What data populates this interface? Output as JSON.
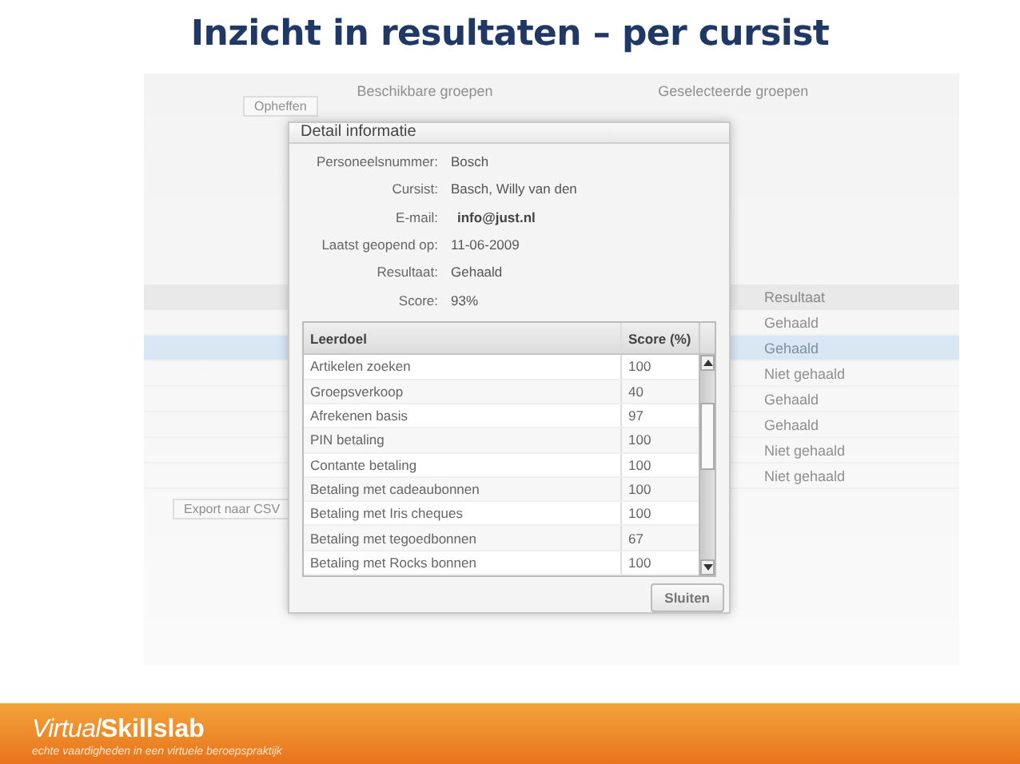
{
  "slide_title": "Inzicht in resultaten – per cursist",
  "background_app": {
    "group_labels": [
      "Beschikbare groepen",
      "Geselecteerde groepen"
    ],
    "buttons": [
      "Opheffen",
      "Export naar CSV"
    ],
    "result_column": "Resultaat",
    "results": [
      {
        "text": "Gehaald",
        "selected": false
      },
      {
        "text": "Gehaald",
        "selected": true
      },
      {
        "text": "Niet gehaald",
        "selected": false
      },
      {
        "text": "Gehaald",
        "selected": false
      },
      {
        "text": "Gehaald",
        "selected": false
      },
      {
        "text": "Niet gehaald",
        "selected": false
      },
      {
        "text": "Niet gehaald",
        "selected": false
      }
    ]
  },
  "dialog": {
    "title": "Detail informatie",
    "fields": [
      {
        "label": "Personeelsnummer:",
        "value": "Bosch",
        "bold": false
      },
      {
        "label": "Cursist:",
        "value": "Basch, Willy van den",
        "bold": false
      },
      {
        "label": "E-mail:",
        "value": "info@just.nl",
        "bold": true
      },
      {
        "label": "Laatst geopend op:",
        "value": "11-06-2009",
        "bold": false
      },
      {
        "label": "Resultaat:",
        "value": "Gehaald",
        "bold": false
      },
      {
        "label": "Score:",
        "value": "93%",
        "bold": false
      }
    ],
    "table": {
      "columns": [
        "Leerdoel",
        "Score (%)"
      ],
      "rows": [
        [
          "Artikelen zoeken",
          "100"
        ],
        [
          "Groepsverkoop",
          "40"
        ],
        [
          "Afrekenen basis",
          "97"
        ],
        [
          "PIN betaling",
          "100"
        ],
        [
          "Contante betaling",
          "100"
        ],
        [
          "Betaling met cadeaubonnen",
          "100"
        ],
        [
          "Betaling met Iris cheques",
          "100"
        ],
        [
          "Betaling met tegoedbonnen",
          "67"
        ],
        [
          "Betaling met Rocks bonnen",
          "100"
        ]
      ]
    },
    "close_button": "Sluiten"
  },
  "footer": {
    "brand_light": "Virtual",
    "brand_bold": "Skillslab",
    "tagline": "echte vaardigheden in een virtuele beroepspraktijk"
  }
}
